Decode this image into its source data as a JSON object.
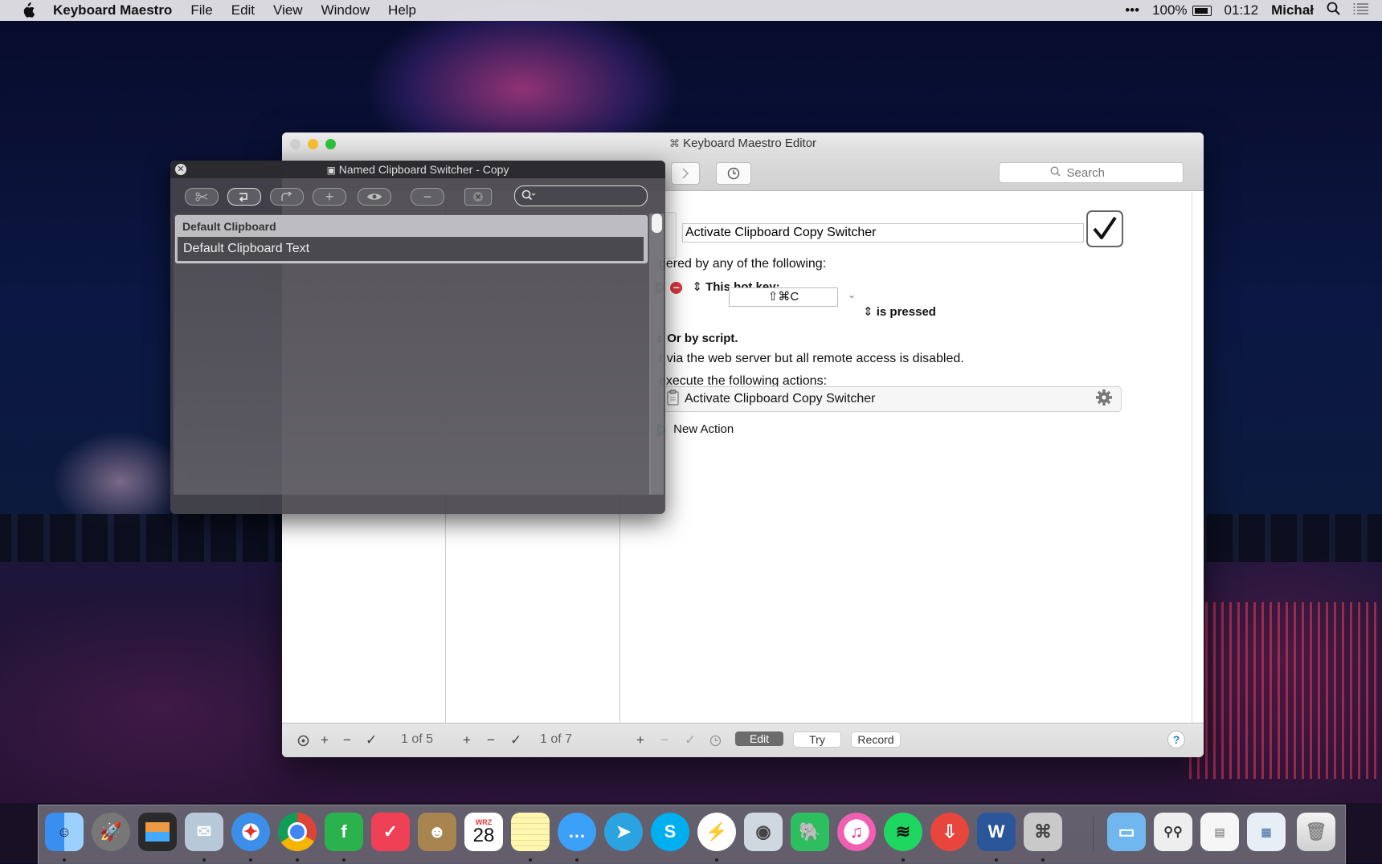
{
  "menubar": {
    "app_name": "Keyboard Maestro",
    "menus": [
      "File",
      "Edit",
      "View",
      "Window",
      "Help"
    ],
    "battery": "100%",
    "time": "01:12",
    "user": "Michał",
    "more": "•••"
  },
  "editor_window": {
    "title": "Keyboard Maestro Editor",
    "search_placeholder": "Search",
    "macro_name": "Activate Clipboard Copy Switcher",
    "triggered_text": "gered by any of the following:",
    "hotkey_label": "This hot key:",
    "hotkey_value": "⇧⌘C",
    "hotkey_state": "is pressed",
    "or_by_script": "Or by script.",
    "web_server_text": "r via the web server but all remote access is disabled.",
    "execute_text": "execute the following actions:",
    "action_name": "Activate Clipboard Copy Switcher",
    "new_action": "New Action",
    "groups_count": "1 of 5",
    "macros_count": "1 of 7",
    "buttons": {
      "edit": "Edit",
      "try": "Try",
      "record": "Record",
      "help": "?"
    }
  },
  "clipboard_window": {
    "title": "Named Clipboard Switcher - Copy",
    "group_header": "Default Clipboard",
    "selected_item": "Default Clipboard Text"
  },
  "dock": {
    "apps": [
      "Finder",
      "Launchpad",
      "Photo Booth",
      "Mail",
      "Safari",
      "Chrome",
      "Feedly",
      "Pocket",
      "Contacts",
      "Calendar",
      "Notes",
      "Messages",
      "Telegram",
      "Skype",
      "Messenger",
      "Preview",
      "Evernote",
      "iTunes",
      "Spotify",
      "Transmit",
      "Word",
      "Keyboard Maestro",
      "Applications",
      "Downloads",
      "Documents",
      "Desktop",
      "Trash"
    ],
    "calendar_month": "WRZ",
    "calendar_day": "28"
  }
}
